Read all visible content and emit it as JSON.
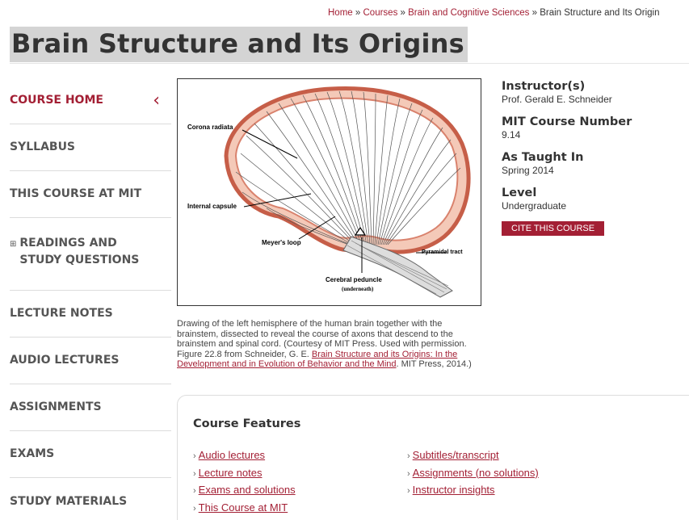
{
  "breadcrumb": {
    "home": "Home",
    "courses": "Courses",
    "department": "Brain and Cognitive Sciences",
    "current": "Brain Structure and Its Origin",
    "separator": "»"
  },
  "page_title": "Brain Structure and Its Origins",
  "sidebar": {
    "items": [
      {
        "label": "COURSE HOME",
        "active": true
      },
      {
        "label": "SYLLABUS"
      },
      {
        "label": "THIS COURSE AT MIT"
      },
      {
        "label_line1": "READINGS AND",
        "label_line2": "STUDY QUESTIONS",
        "expandable": true
      },
      {
        "label": "LECTURE NOTES"
      },
      {
        "label": "AUDIO LECTURES"
      },
      {
        "label": "ASSIGNMENTS"
      },
      {
        "label": "EXAMS"
      },
      {
        "label": "STUDY MATERIALS"
      }
    ],
    "active_chevron": "‹",
    "expand_icon": "⊞"
  },
  "figure": {
    "labels": {
      "corona": "Corona radiata",
      "internal": "Internal capsule",
      "meyer": "Meyer's loop",
      "pyramidal": "Pyramidal tract",
      "peduncle": "Cerebral peduncle",
      "underneath": "(underneath)"
    }
  },
  "caption": {
    "text": "Drawing of the left hemisphere of the human brain together with the brainstem, dissected to reveal the course of axons that descend to the brainstem and spinal cord. (Courtesy of MIT Press. Used with permission. Figure 22.8 from Schneider, G. E. ",
    "link": "Brain Structure and its Origins: In the Development and in Evolution of Behavior and the Mind",
    "tail": ". MIT Press, 2014.)"
  },
  "info": {
    "instructor_label": "Instructor(s)",
    "instructor_value": "Prof. Gerald E. Schneider",
    "number_label": "MIT Course Number",
    "number_value": "9.14",
    "taught_label": "As Taught In",
    "taught_value": "Spring 2014",
    "level_label": "Level",
    "level_value": "Undergraduate",
    "cite_button": "CITE THIS COURSE"
  },
  "features": {
    "title": "Course Features",
    "arrow": "›",
    "col1": [
      "Audio lectures",
      "Lecture notes",
      "Exams and solutions",
      "This Course at MIT"
    ],
    "col2": [
      "Subtitles/transcript",
      "Assignments (no solutions)",
      "Instructor insights"
    ]
  },
  "colors": {
    "accent": "#a31f34",
    "title_highlight": "#d4d4d4"
  }
}
